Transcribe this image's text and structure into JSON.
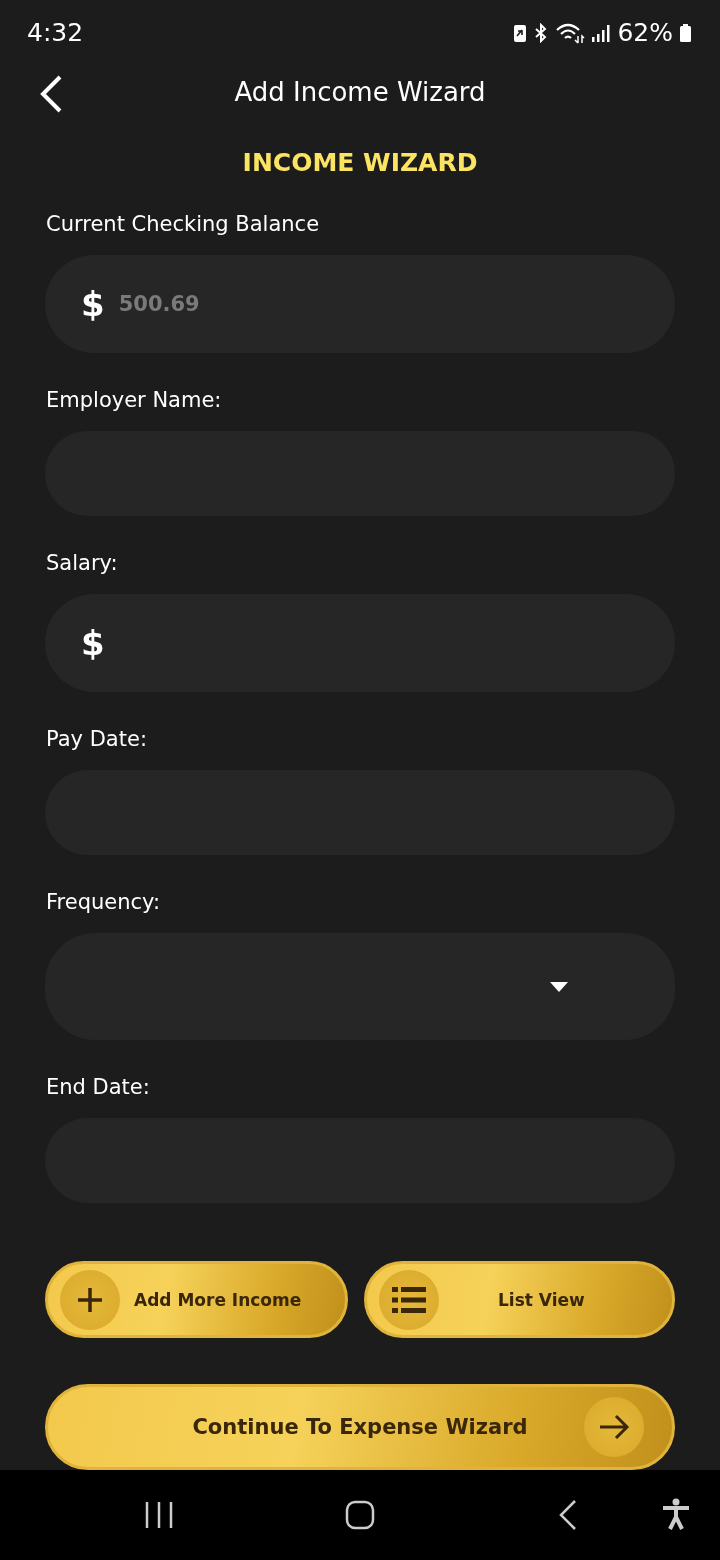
{
  "status_bar": {
    "time": "4:32",
    "battery": "62%"
  },
  "header": {
    "title": "Add Income Wizard"
  },
  "section_title": "INCOME WIZARD",
  "fields": [
    {
      "kind": "currency",
      "label": "Current Checking Balance",
      "prefix": "$",
      "placeholder": "500.69"
    },
    {
      "kind": "text",
      "label": "Employer Name:"
    },
    {
      "kind": "currency",
      "label": "Salary:",
      "prefix": "$"
    },
    {
      "kind": "text",
      "label": "Pay Date:"
    },
    {
      "kind": "dropdown",
      "label": "Frequency:"
    },
    {
      "kind": "text",
      "label": "End Date:"
    }
  ],
  "actions": [
    {
      "kind": "add",
      "label": "Add More Income"
    },
    {
      "kind": "list",
      "label": "List View"
    }
  ],
  "continue_button": {
    "label": "Continue To Expense Wizard"
  }
}
